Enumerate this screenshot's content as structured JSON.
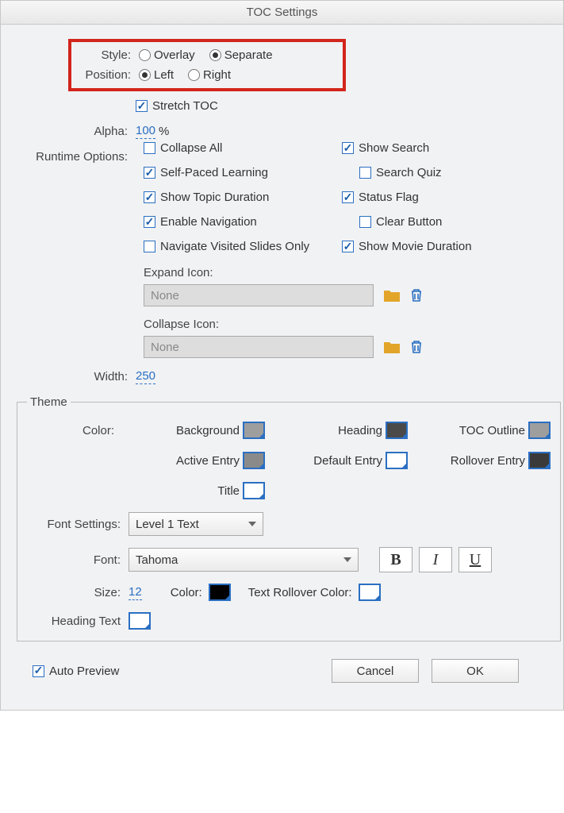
{
  "title": "TOC Settings",
  "style": {
    "label": "Style:",
    "options": [
      "Overlay",
      "Separate"
    ],
    "selected": "Separate"
  },
  "position": {
    "label": "Position:",
    "options": [
      "Left",
      "Right"
    ],
    "selected": "Left"
  },
  "stretch_toc": {
    "label": "Stretch TOC",
    "checked": true
  },
  "alpha": {
    "label": "Alpha:",
    "value": "100",
    "unit": "%"
  },
  "runtime": {
    "label": "Runtime Options:",
    "items": [
      {
        "label": "Collapse All",
        "checked": false
      },
      {
        "label": "Show Search",
        "checked": true
      },
      {
        "label": "Self-Paced Learning",
        "checked": true
      },
      {
        "label": "Search Quiz",
        "checked": false
      },
      {
        "label": "Show Topic Duration",
        "checked": true
      },
      {
        "label": "Status Flag",
        "checked": true
      },
      {
        "label": "Enable Navigation",
        "checked": true
      },
      {
        "label": "Clear Button",
        "checked": false
      },
      {
        "label": "Navigate Visited Slides Only",
        "checked": false
      },
      {
        "label": "Show Movie Duration",
        "checked": true
      }
    ]
  },
  "expand_icon": {
    "label": "Expand Icon:",
    "value": "None"
  },
  "collapse_icon": {
    "label": "Collapse Icon:",
    "value": "None"
  },
  "width": {
    "label": "Width:",
    "value": "250"
  },
  "theme": {
    "legend": "Theme",
    "color_label": "Color:",
    "colors": {
      "background": {
        "label": "Background",
        "hex": "#9e9e9e"
      },
      "heading": {
        "label": "Heading",
        "hex": "#4a4a4a"
      },
      "toc_outline": {
        "label": "TOC Outline",
        "hex": "#9e9e9e"
      },
      "active_entry": {
        "label": "Active Entry",
        "hex": "#8a8a8a"
      },
      "default_entry": {
        "label": "Default Entry",
        "hex": "#ffffff"
      },
      "rollover_entry": {
        "label": "Rollover Entry",
        "hex": "#3a3a3a"
      },
      "title": {
        "label": "Title",
        "hex": "#ffffff"
      }
    },
    "font_settings": {
      "label": "Font Settings:",
      "value": "Level 1 Text"
    },
    "font": {
      "label": "Font:",
      "value": "Tahoma"
    },
    "bold": "B",
    "italic": "I",
    "underline": "U",
    "size": {
      "label": "Size:",
      "value": "12"
    },
    "text_color": {
      "label": "Color:",
      "hex": "#000000"
    },
    "text_rollover": {
      "label": "Text Rollover Color:",
      "hex": "#ffffff"
    },
    "heading_text": {
      "label": "Heading Text",
      "hex": "#ffffff"
    }
  },
  "auto_preview": {
    "label": "Auto Preview",
    "checked": true
  },
  "buttons": {
    "cancel": "Cancel",
    "ok": "OK"
  }
}
